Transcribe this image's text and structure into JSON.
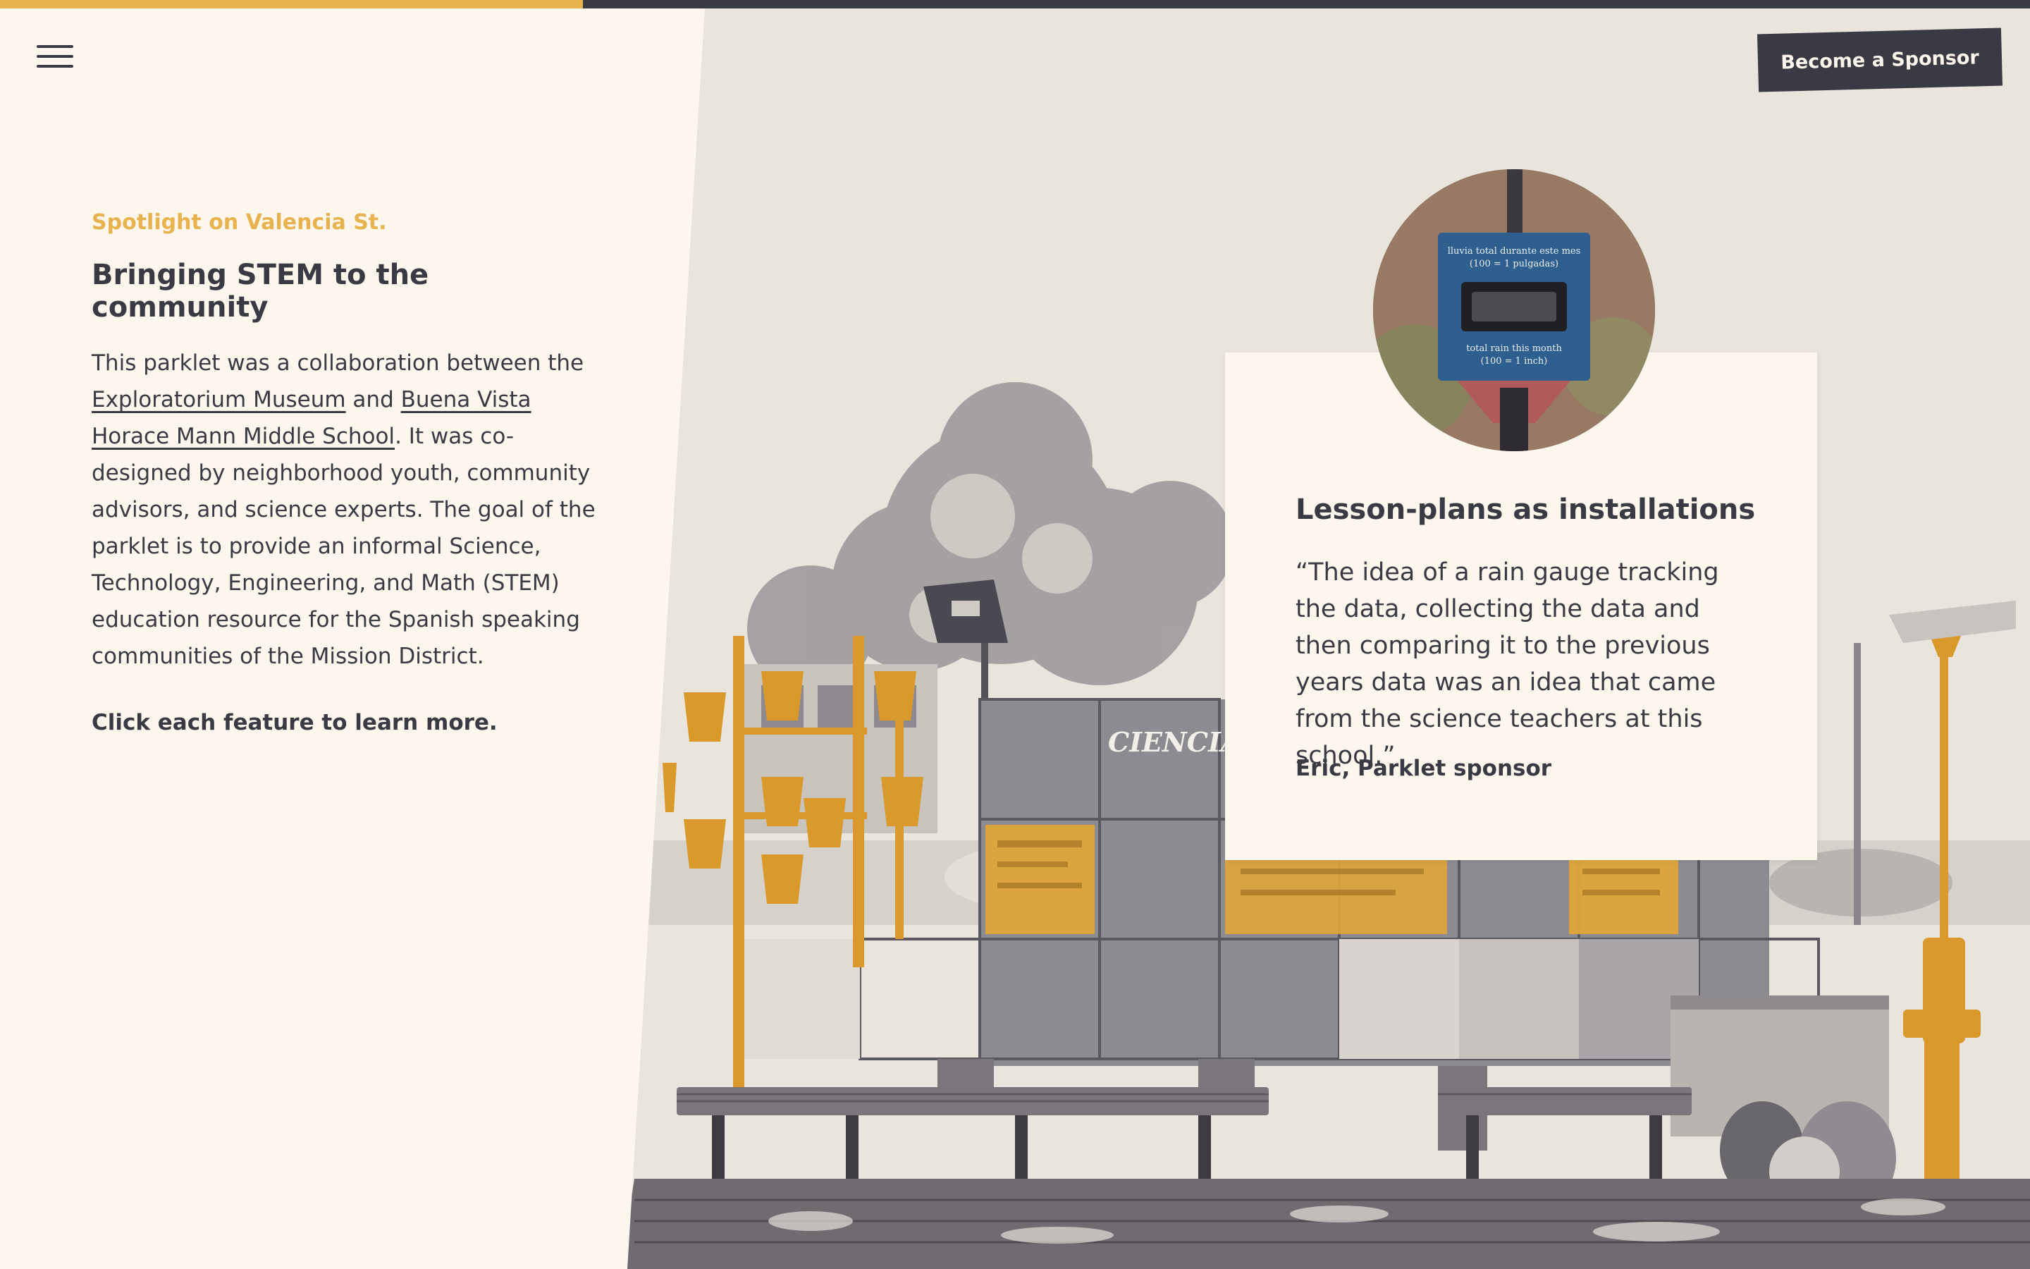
{
  "progress": {
    "value_percent": 28.7,
    "fill_color": "#e8b24f",
    "track_color": "#3a3a44"
  },
  "nav": {
    "menu_icon": "hamburger-icon"
  },
  "header": {
    "sponsor_label": "Become a Sponsor"
  },
  "intro": {
    "eyebrow": "Spotlight on Valencia St.",
    "heading": "Bringing STEM to the community",
    "body_prefix": "This parklet was a collaboration between the ",
    "link1": "Exploratorium Museum",
    "conj": " and ",
    "link2": "Buena Vista Horace Mann Middle School",
    "body_suffix": ". It was co-designed by neighborhood youth, community advisors, and science experts. The goal of the parklet is to provide an informal Science, Technology, Engineering, and Math (STEM) education resource for the Spanish speaking communities of the Mission District.",
    "cta": "Click each feature to learn more."
  },
  "photo": {
    "wall_sign": "CIENCIA",
    "accent_color": "#e0a53a"
  },
  "card": {
    "avatar_sign_line1": "lluvia total durante este mes",
    "avatar_sign_line2": "(100 = 1 pulgadas)",
    "avatar_sign_line3": "total rain this month",
    "avatar_sign_line4": "(100 = 1 inch)",
    "title": "Lesson-plans as installations",
    "quote": "“The idea of a rain gauge tracking the data, collecting the data and then comparing it to the previous years data was an idea that came from the science teachers at this school.”",
    "author": "Eric, Parklet sponsor"
  },
  "colors": {
    "background": "#fcf6ec",
    "ink": "#3a3a44",
    "accent": "#e8b24f"
  }
}
